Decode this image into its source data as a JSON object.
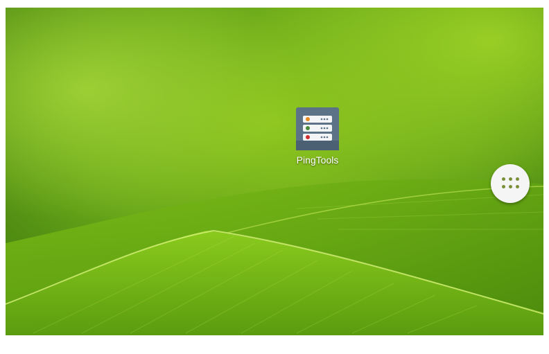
{
  "desktop": {
    "app_shortcut": {
      "label": "PingTools",
      "icon": "server-rack-icon"
    },
    "all_apps_button": {
      "icon": "apps-grid-icon"
    }
  },
  "colors": {
    "wallpaper_light": "#a6d92a",
    "wallpaper_mid": "#6aa81a",
    "wallpaper_dark": "#2f6b0a",
    "icon_tile": "#5b7287",
    "launcher_button": "#f5f5f5",
    "launcher_dots": "#7a8f3a"
  }
}
